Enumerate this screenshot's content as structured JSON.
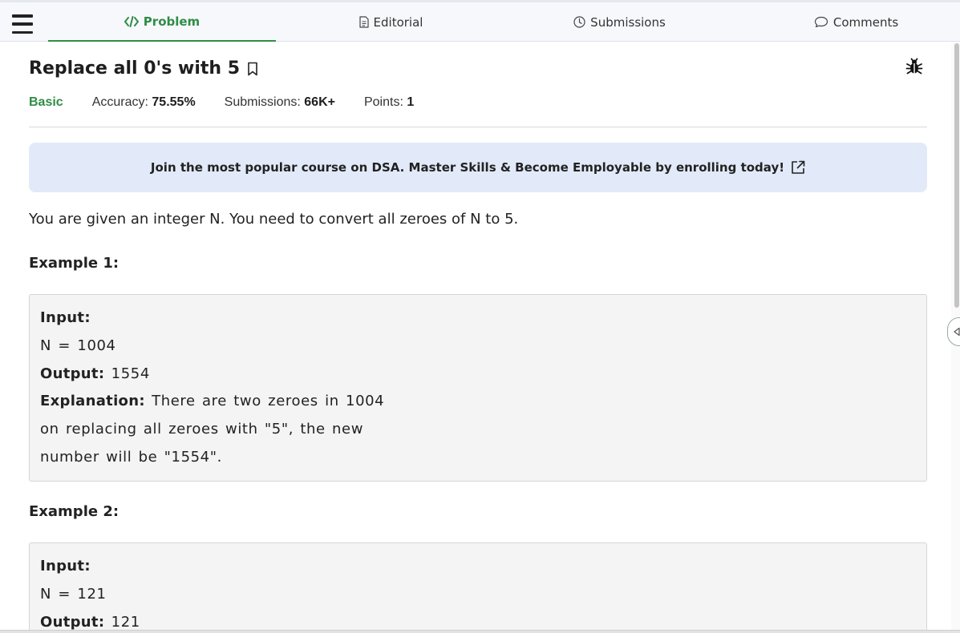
{
  "tabs": {
    "problem": "Problem",
    "editorial": "Editorial",
    "submissions": "Submissions",
    "comments": "Comments"
  },
  "problem": {
    "title": "Replace all 0's with 5",
    "difficulty": "Basic",
    "accuracy_label": "Accuracy:",
    "accuracy_value": "75.55%",
    "submissions_label": "Submissions:",
    "submissions_value": "66K+",
    "points_label": "Points:",
    "points_value": "1"
  },
  "banner": {
    "text": "Join the most popular course on DSA. Master Skills & Become Employable by enrolling today!"
  },
  "description": "You are given an integer N. You need to convert all zeroes of N to 5.",
  "examples": [
    {
      "heading": "Example 1:",
      "input_label": "Input:",
      "input_value": "N = 1004",
      "output_label": "Output:",
      "output_value": "1554",
      "explanation_label": "Explanation:",
      "explanation_lines": [
        "There are two zeroes in 1004",
        "on replacing all zeroes with \"5\", the new",
        "number will be \"1554\"."
      ]
    },
    {
      "heading": "Example 2:",
      "input_label": "Input:",
      "input_value": "N = 121",
      "output_label": "Output:",
      "output_value": "121"
    }
  ],
  "colors": {
    "accent_green": "#2f8d46",
    "banner_bg": "#e2eaf9",
    "example_bg": "#f4f4f4"
  },
  "icons": [
    "menu-icon",
    "code-icon",
    "document-icon",
    "clock-icon",
    "comment-icon",
    "bookmark-icon",
    "bug-icon",
    "external-link-icon",
    "collapse-arrow-icon"
  ]
}
